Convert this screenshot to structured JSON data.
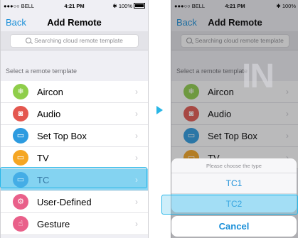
{
  "status_bar": {
    "carrier": "●●●○○ BELL",
    "time": "4:21 PM",
    "battery": "100%"
  },
  "nav": {
    "back_label": "Back",
    "title": "Add Remote"
  },
  "search": {
    "placeholder": "Searching cloud remote template"
  },
  "section_header": "Select a remote template",
  "left_items": [
    {
      "label": "Aircon",
      "icon": "snowflake-icon",
      "color": "#8fce4a"
    },
    {
      "label": "Audio",
      "icon": "speaker-icon",
      "color": "#e4574f"
    },
    {
      "label": "Set Top Box",
      "icon": "set-top-box-icon",
      "color": "#2d9be0"
    },
    {
      "label": "TV",
      "icon": "tv-icon",
      "color": "#f5a623"
    },
    {
      "label": "TC",
      "icon": "tv-icon",
      "color": "#2d9be0",
      "selected": true
    },
    {
      "label": "User-Defined",
      "icon": "user-defined-icon",
      "color": "#e9608a"
    },
    {
      "label": "Gesture",
      "icon": "gesture-icon",
      "color": "#e9608a"
    }
  ],
  "right_items": [
    {
      "label": "Aircon",
      "icon": "snowflake-icon",
      "color": "#8fce4a"
    },
    {
      "label": "Audio",
      "icon": "speaker-icon",
      "color": "#e4574f"
    },
    {
      "label": "Set Top Box",
      "icon": "set-top-box-icon",
      "color": "#2d9be0"
    },
    {
      "label": "TV",
      "icon": "tv-icon",
      "color": "#f5a623"
    }
  ],
  "watermark": "IN",
  "action_sheet": {
    "title": "Please choose the type",
    "options": [
      "TC1",
      "TC2"
    ],
    "cancel_label": "Cancel"
  },
  "colors": {
    "accent": "#1a8fd8",
    "highlight": "#27b6e8"
  }
}
